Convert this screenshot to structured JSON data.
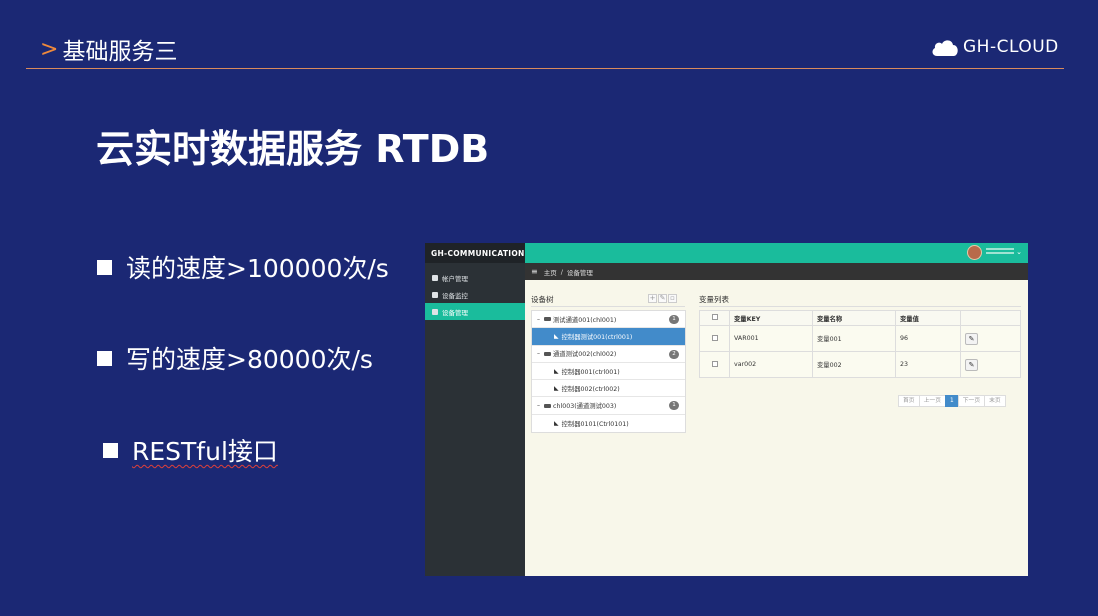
{
  "header": {
    "chevron": ">",
    "section_title": "基础服务三",
    "logo_text": "GH-CLOUD",
    "logo_icon": "cloud-icon"
  },
  "title": "云实时数据服务 RTDB",
  "bullets": [
    "读的速度>100000次/s",
    "写的速度>80000次/s",
    "RESTful接口"
  ],
  "app": {
    "brand": "GH-COMMUNICATION",
    "nav": [
      {
        "label": "帐户管理",
        "icon": "user-icon",
        "active": false
      },
      {
        "label": "设备监控",
        "icon": "dashboard-icon",
        "active": false
      },
      {
        "label": "设备管理",
        "icon": "camera-icon",
        "active": true
      }
    ],
    "breadcrumb": {
      "home": "主页",
      "sep": "/",
      "current": "设备管理"
    },
    "tree": {
      "title": "设备树",
      "nodes": [
        {
          "label": "测试通道001(chl001)",
          "badge": "1"
        },
        {
          "label": "控制器测试001(ctrl001)",
          "selected": true
        },
        {
          "label": "通道测试002(chl002)",
          "badge": "2"
        },
        {
          "label": "控制器001(ctrl001)"
        },
        {
          "label": "控制器002(ctrl002)"
        },
        {
          "label": "chl003(通道测试003)",
          "badge": "1"
        },
        {
          "label": "控制器0101(Ctrl0101)"
        }
      ]
    },
    "list": {
      "title": "变量列表",
      "columns": [
        "变量KEY",
        "变量名称",
        "变量值"
      ],
      "rows": [
        {
          "key": "VAR001",
          "name": "变量001",
          "value": "96"
        },
        {
          "key": "var002",
          "name": "变量002",
          "value": "23"
        }
      ]
    },
    "pager": {
      "first": "首页",
      "prev": "上一页",
      "current": "1",
      "next": "下一页",
      "last": "末页"
    },
    "colors": {
      "accent": "#1abc9c",
      "selected": "#428bca",
      "sidebar": "#2b3136"
    }
  }
}
